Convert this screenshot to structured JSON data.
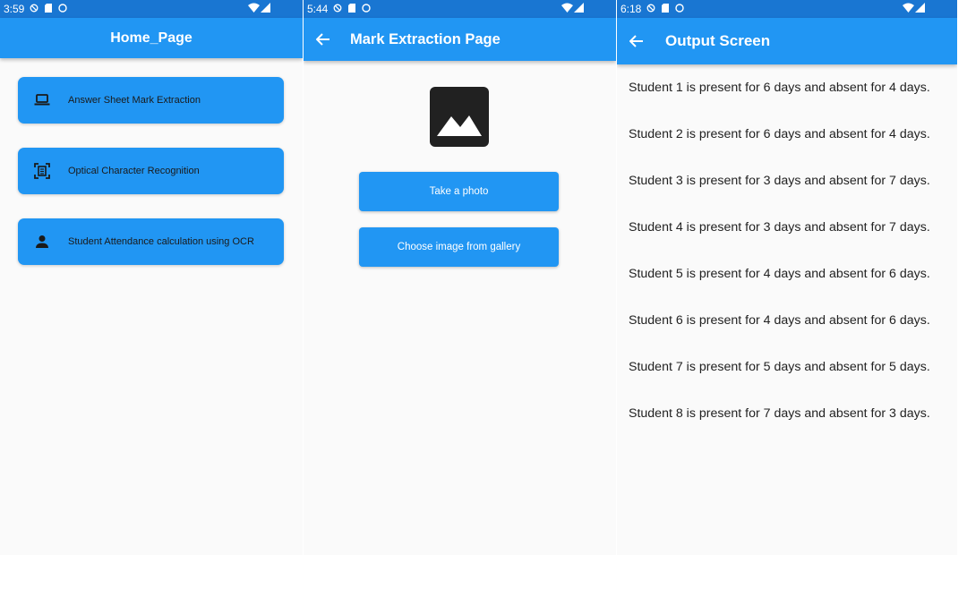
{
  "colors": {
    "statusbar": "#1976d2",
    "appbar": "#2196f3",
    "button": "#2196f3",
    "background": "#fafafa"
  },
  "home": {
    "status_time": "3:59",
    "title": "Home_Page",
    "buttons": [
      {
        "label": "Answer Sheet Mark Extraction",
        "icon": "laptop-icon"
      },
      {
        "label": "Optical Character Recognition",
        "icon": "document-scanner-icon"
      },
      {
        "label": "Student Attendance calculation using OCR",
        "icon": "person-icon"
      }
    ]
  },
  "mark": {
    "status_time": "5:44",
    "title": "Mark Extraction Page",
    "image_icon": "image-icon",
    "take_photo_label": "Take a photo",
    "gallery_label": "Choose image from gallery"
  },
  "output": {
    "status_time": "6:18",
    "title": "Output Screen",
    "lines": [
      "Student 1 is present for 6 days and absent for 4 days.",
      "Student 2 is present for 6 days and absent for 4 days.",
      "Student 3 is present for 3 days and absent for 7 days.",
      "Student 4 is present for 3 days and absent for 7 days.",
      "Student 5 is present for 4 days and absent for 6 days.",
      "Student 6 is present for 4 days and absent for 6 days.",
      "Student 7 is present for 5 days and absent for 5 days.",
      "Student 8 is present for 7 days and absent for 3 days."
    ]
  }
}
